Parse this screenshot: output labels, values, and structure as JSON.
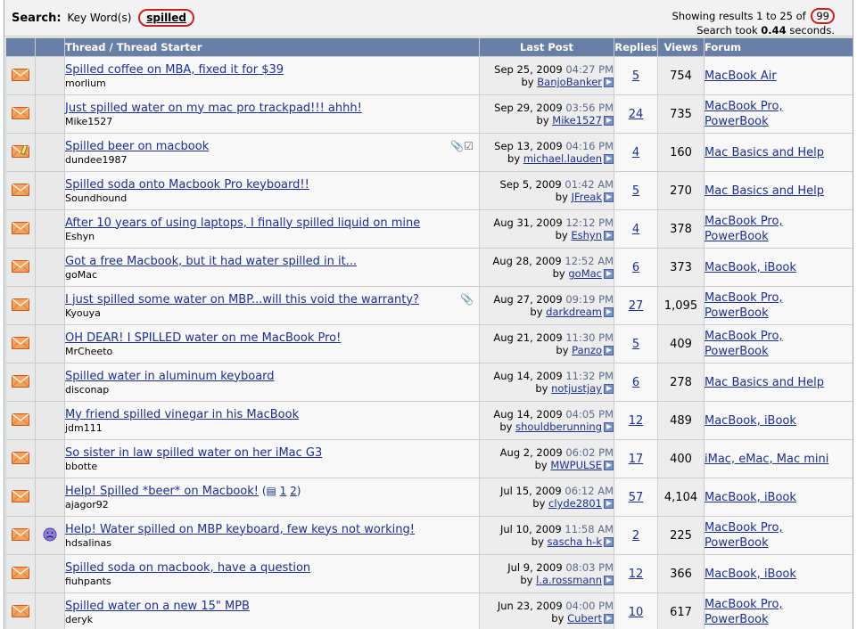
{
  "search": {
    "label": "Search:",
    "keyword_label": "Key Word(s)",
    "keyword": "spilled",
    "showing_prefix": "Showing results 1 to 25 of",
    "total": "99",
    "took_prefix": "Search took",
    "took_value": "0.44",
    "took_suffix": "seconds."
  },
  "columns": {
    "thread": "Thread / Thread Starter",
    "last_post": "Last Post",
    "replies": "Replies",
    "views": "Views",
    "forum": "Forum"
  },
  "colors": {
    "header_bg": "#6a7fa5",
    "link": "#1d2f8c",
    "highlight_circle": "#cc2020",
    "envelope": "#e8703a"
  },
  "threads": [
    {
      "status_icon": "envelope-icon",
      "post_icon": "",
      "title": "Spilled coffee on MBA, fixed it for $39",
      "starter": "morlium",
      "attach": "",
      "pages": [],
      "date": "Sep 25, 2009",
      "time": "04:27 PM",
      "by_prefix": "by",
      "last_user": "BanjoBanker",
      "replies": "5",
      "views": "754",
      "forum": [
        "MacBook Air"
      ]
    },
    {
      "status_icon": "envelope-icon",
      "post_icon": "",
      "title": "Just spilled water on my mac pro trackpad!!! ahhh!",
      "starter": "Mike1527",
      "attach": "",
      "pages": [],
      "date": "Sep 29, 2009",
      "time": "03:56 PM",
      "by_prefix": "by",
      "last_user": "Mike1527",
      "replies": "24",
      "views": "735",
      "forum": [
        "MacBook Pro,",
        "PowerBook"
      ]
    },
    {
      "status_icon": "envelope-pencil-icon",
      "post_icon": "",
      "title": "Spilled beer on macbook",
      "starter": "dundee1987",
      "attach": "📎☑",
      "pages": [],
      "date": "Sep 13, 2009",
      "time": "04:16 PM",
      "by_prefix": "by",
      "last_user": "michael.lauden",
      "replies": "4",
      "views": "160",
      "forum": [
        "Mac Basics and Help"
      ]
    },
    {
      "status_icon": "envelope-icon",
      "post_icon": "",
      "title": "Spilled soda onto Macbook Pro keyboard!!",
      "starter": "Soundhound",
      "attach": "",
      "pages": [],
      "date": "Sep 5, 2009",
      "time": "01:42 AM",
      "by_prefix": "by",
      "last_user": "JFreak",
      "replies": "5",
      "views": "270",
      "forum": [
        "Mac Basics and Help"
      ]
    },
    {
      "status_icon": "envelope-icon",
      "post_icon": "",
      "title": "After 10 years of using laptops, I finally spilled liquid on mine",
      "starter": "Eshyn",
      "attach": "",
      "pages": [],
      "date": "Aug 31, 2009",
      "time": "12:12 PM",
      "by_prefix": "by",
      "last_user": "Eshyn",
      "replies": "4",
      "views": "378",
      "forum": [
        "MacBook Pro,",
        "PowerBook"
      ]
    },
    {
      "status_icon": "envelope-icon",
      "post_icon": "",
      "title": "Got a free Macbook, but it had water spilled in it...",
      "starter": "goMac",
      "attach": "",
      "pages": [],
      "date": "Aug 28, 2009",
      "time": "12:52 AM",
      "by_prefix": "by",
      "last_user": "goMac",
      "replies": "6",
      "views": "373",
      "forum": [
        "MacBook, iBook"
      ]
    },
    {
      "status_icon": "envelope-icon",
      "post_icon": "",
      "title": "I just spilled some water on MBP...will this void the warranty?",
      "starter": "Kyouya",
      "attach": "📎",
      "pages": [],
      "date": "Aug 27, 2009",
      "time": "09:19 PM",
      "by_prefix": "by",
      "last_user": "darkdream",
      "replies": "27",
      "views": "1,095",
      "forum": [
        "MacBook Pro,",
        "PowerBook"
      ]
    },
    {
      "status_icon": "envelope-icon",
      "post_icon": "",
      "title": "OH DEAR! I SPILLED water on me MacBook Pro!",
      "starter": "MrCheeto",
      "attach": "",
      "pages": [],
      "date": "Aug 21, 2009",
      "time": "11:30 PM",
      "by_prefix": "by",
      "last_user": "Panzo",
      "replies": "5",
      "views": "409",
      "forum": [
        "MacBook Pro,",
        "PowerBook"
      ]
    },
    {
      "status_icon": "envelope-icon",
      "post_icon": "",
      "title": "Spilled water in aluminum keyboard",
      "starter": "disconap",
      "attach": "",
      "pages": [],
      "date": "Aug 14, 2009",
      "time": "11:32 PM",
      "by_prefix": "by",
      "last_user": "notjustjay",
      "replies": "6",
      "views": "278",
      "forum": [
        "Mac Basics and Help"
      ]
    },
    {
      "status_icon": "envelope-icon",
      "post_icon": "",
      "title": "My friend spilled vinegar in his MacBook",
      "starter": "jdm111",
      "attach": "",
      "pages": [],
      "date": "Aug 14, 2009",
      "time": "04:05 PM",
      "by_prefix": "by",
      "last_user": "shouldberunning",
      "replies": "12",
      "views": "489",
      "forum": [
        "MacBook, iBook"
      ]
    },
    {
      "status_icon": "envelope-icon",
      "post_icon": "",
      "title": "So sister in law spilled water on her iMac G3",
      "starter": "bbotte",
      "attach": "",
      "pages": [],
      "date": "Aug 2, 2009",
      "time": "06:02 PM",
      "by_prefix": "by",
      "last_user": "MWPULSE",
      "replies": "17",
      "views": "400",
      "forum": [
        "iMac, eMac, Mac mini"
      ]
    },
    {
      "status_icon": "envelope-icon",
      "post_icon": "",
      "title": "Help! Spilled *beer* on Macbook!",
      "starter": "ajagor92",
      "attach": "",
      "pages": [
        "1",
        "2"
      ],
      "date": "Jul 15, 2009",
      "time": "06:12 AM",
      "by_prefix": "by",
      "last_user": "clyde2801",
      "replies": "57",
      "views": "4,104",
      "forum": [
        "MacBook, iBook"
      ]
    },
    {
      "status_icon": "envelope-icon",
      "post_icon": "sad-face-icon",
      "title": "Help! Water spilled on MBP keyboard, few keys not working!",
      "starter": "hdsalinas",
      "attach": "",
      "pages": [],
      "date": "Jul 10, 2009",
      "time": "11:58 AM",
      "by_prefix": "by",
      "last_user": "sascha h-k",
      "replies": "2",
      "views": "225",
      "forum": [
        "MacBook Pro,",
        "PowerBook"
      ]
    },
    {
      "status_icon": "envelope-icon",
      "post_icon": "",
      "title": "Spilled soda on macbook, have a question",
      "starter": "fiuhpants",
      "attach": "",
      "pages": [],
      "date": "Jul 9, 2009",
      "time": "08:03 PM",
      "by_prefix": "by",
      "last_user": "l.a.rossmann",
      "replies": "12",
      "views": "366",
      "forum": [
        "MacBook, iBook"
      ]
    },
    {
      "status_icon": "envelope-icon",
      "post_icon": "",
      "title": "Spilled water on a new 15\" MPB",
      "starter": "deryk",
      "attach": "",
      "pages": [],
      "date": "Jun 23, 2009",
      "time": "04:00 PM",
      "by_prefix": "by",
      "last_user": "Cubert",
      "replies": "10",
      "views": "617",
      "forum": [
        "MacBook Pro,",
        "PowerBook"
      ]
    }
  ]
}
